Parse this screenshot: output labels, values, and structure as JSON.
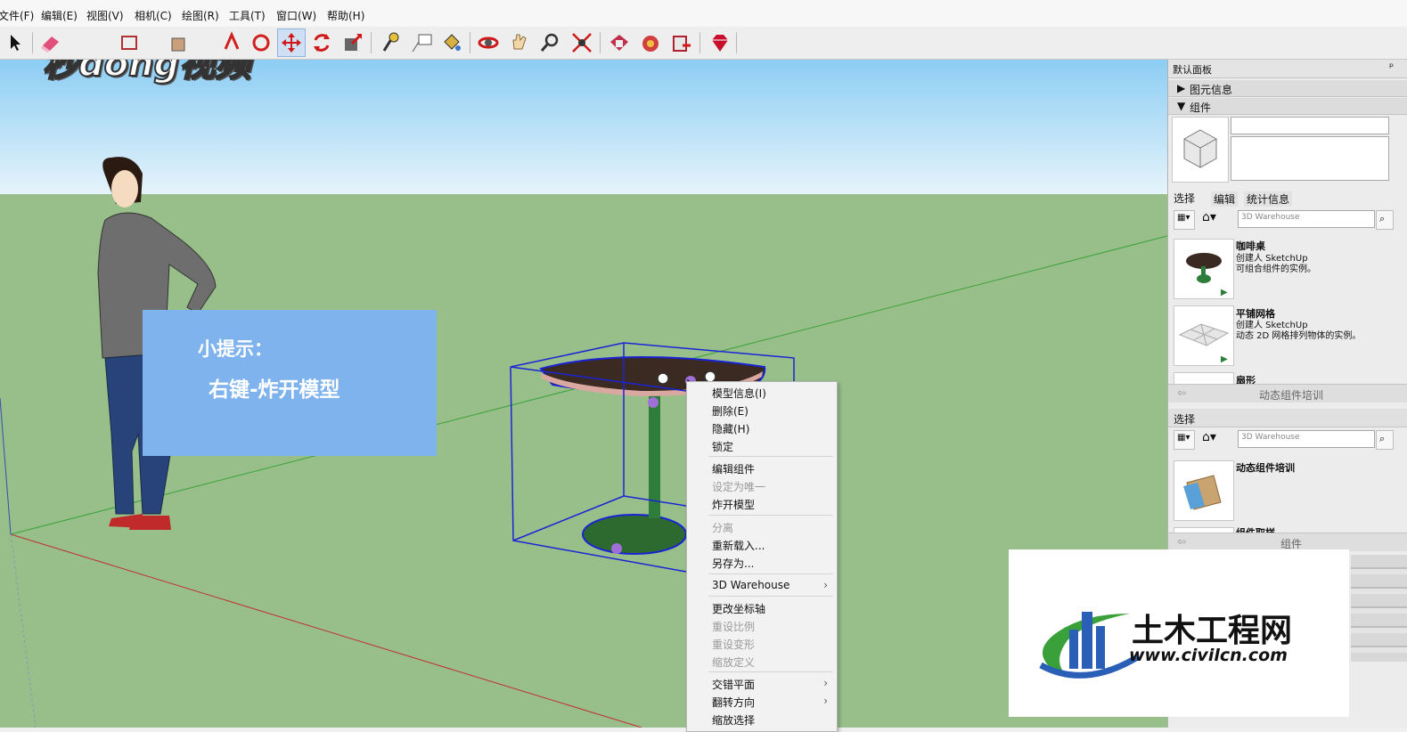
{
  "menu": [
    "文件(F)",
    "编辑(E)",
    "视图(V)",
    "相机(C)",
    "绘图(R)",
    "工具(T)",
    "窗口(W)",
    "帮助(H)"
  ],
  "watermark": {
    "text": "秒dong视频"
  },
  "tip": {
    "title": "小提示：",
    "text": "右键-炸开模型"
  },
  "context_menu": [
    {
      "label": "模型信息(I)",
      "disabled": false
    },
    {
      "label": "删除(E)",
      "disabled": false
    },
    {
      "label": "隐藏(H)",
      "disabled": false
    },
    {
      "label": "锁定",
      "disabled": false
    },
    {
      "label": "编辑组件",
      "disabled": false
    },
    {
      "label": "设定为唯一",
      "disabled": true
    },
    {
      "label": "炸开模型",
      "disabled": false
    },
    {
      "label": "分离",
      "disabled": true
    },
    {
      "label": "重新载入...",
      "disabled": false
    },
    {
      "label": "另存为...",
      "disabled": false
    },
    {
      "label": "3D Warehouse",
      "disabled": false,
      "submenu": true
    },
    {
      "label": "更改坐标轴",
      "disabled": false
    },
    {
      "label": "重设比例",
      "disabled": true
    },
    {
      "label": "重设变形",
      "disabled": true
    },
    {
      "label": "缩放定义",
      "disabled": true
    },
    {
      "label": "交错平面",
      "disabled": false,
      "submenu": true
    },
    {
      "label": "翻转方向",
      "disabled": false,
      "submenu": true
    },
    {
      "label": "缩放选择",
      "disabled": false
    }
  ],
  "panel": {
    "title": "默认面板",
    "pin": "ᵖ",
    "sections": {
      "entity_info": "图元信息",
      "components": "组件"
    },
    "tabs": [
      "选择",
      "编辑",
      "统计信息"
    ],
    "search_placeholder": "3D Warehouse",
    "items": [
      {
        "name": "咖啡桌",
        "author": "创建人 SketchUp",
        "desc": "可组合组件的实例。"
      },
      {
        "name": "平铺网格",
        "author": "创建人 SketchUp",
        "desc": "动态 2D 网格排列物体的实例。"
      },
      {
        "name": "扇形"
      }
    ],
    "nav_label_1": "动态组件培训",
    "select_header": "选择",
    "search_placeholder_2": "3D Warehouse",
    "item2_name": "动态组件培训",
    "item3_name": "组件取样",
    "nav_label_2": "组件"
  },
  "civil": {
    "cn": "土木工程网",
    "url": "www.civilcn.com"
  },
  "colors": {
    "sky_top": "#9fd3f5",
    "ground": "#98bf8a",
    "tip_bg": "#7fb3ee",
    "selection_blue": "#1a24d6",
    "table_top": "#3a2a22",
    "table_leg": "#2e7d3a"
  }
}
